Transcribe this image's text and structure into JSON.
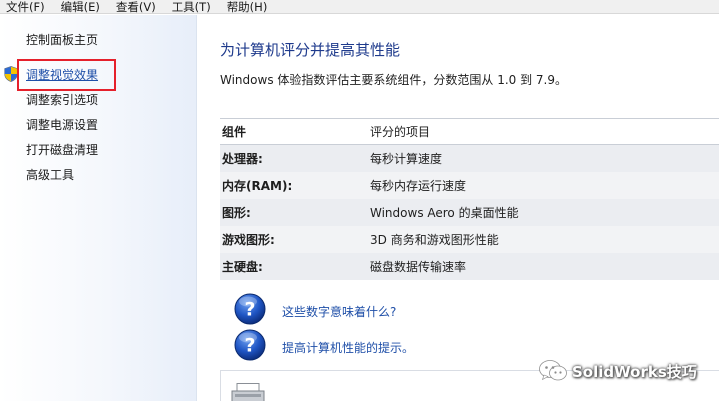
{
  "menubar": {
    "items": [
      "文件(F)",
      "编辑(E)",
      "查看(V)",
      "工具(T)",
      "帮助(H)"
    ]
  },
  "sidebar": {
    "home_link": "控制面板主页",
    "items": [
      "调整视觉效果",
      "调整索引选项",
      "调整电源设置",
      "打开磁盘清理",
      "高级工具"
    ]
  },
  "main": {
    "title": "为计算机评分并提高其性能",
    "description": "Windows 体验指数评估主要系统组件，分数范围从 1.0 到 7.9。",
    "table": {
      "headers": [
        "组件",
        "评分的项目"
      ],
      "rows": [
        {
          "component": "处理器:",
          "rated": "每秒计算速度"
        },
        {
          "component": "内存(RAM):",
          "rated": "每秒内存运行速度"
        },
        {
          "component": "图形:",
          "rated": "Windows Aero 的桌面性能"
        },
        {
          "component": "游戏图形:",
          "rated": "3D 商务和游戏图形性能"
        },
        {
          "component": "主硬盘:",
          "rated": "磁盘数据传输速率"
        }
      ]
    },
    "help_links": [
      "这些数字意味着什么?",
      "提高计算机性能的提示。"
    ]
  },
  "watermark": {
    "text": "SolidWorks技巧"
  },
  "colors": {
    "link_blue": "#1f4fa8",
    "title_blue": "#1e3a8c",
    "highlight_red": "#e5202b"
  }
}
